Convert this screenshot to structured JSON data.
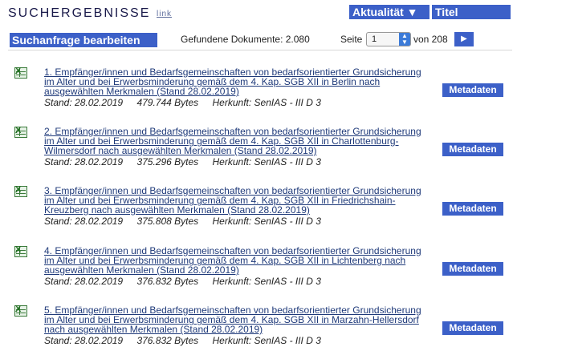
{
  "header": {
    "title": "SUCHERGEBNISSE",
    "link_label": "link",
    "sort_date_label": "Aktualität ▼",
    "sort_title_label": "Titel"
  },
  "toolbar": {
    "edit_query_label": "Suchanfrage bearbeiten",
    "found_documents": "Gefundene Dokumente: 2.080",
    "page_label": "Seite",
    "page_value": "1",
    "of_label": "von 208",
    "next_icon": "▶"
  },
  "results": [
    {
      "title": "1. Empfänger/innen und Bedarfsgemeinschaften von bedarfsorientierter Grundsicherung im Alter und bei Erwerbsminderung gemäß dem 4. Kap. SGB XII in Berlin nach ausgewählten Merkmalen (Stand 28.02.2019)",
      "stand": "Stand: 28.02.2019",
      "size": "479.744 Bytes",
      "origin": "Herkunft: SenIAS - III D 3",
      "meta_label": "Metadaten"
    },
    {
      "title": "2. Empfänger/innen und Bedarfsgemeinschaften von bedarfsorientierter Grundsicherung im Alter und bei Erwerbsminderung gemäß dem 4. Kap. SGB XII in Charlottenburg-Wilmersdorf nach ausgewählten Merkmalen (Stand 28.02.2019)",
      "stand": "Stand: 28.02.2019",
      "size": "375.296 Bytes",
      "origin": "Herkunft: SenIAS - III D 3",
      "meta_label": "Metadaten"
    },
    {
      "title": "3. Empfänger/innen und Bedarfsgemeinschaften von bedarfsorientierter Grundsicherung im Alter und bei Erwerbsminderung gemäß dem 4. Kap. SGB XII in Friedrichshain-Kreuzberg nach ausgewählten Merkmalen (Stand 28.02.2019)",
      "stand": "Stand: 28.02.2019",
      "size": "375.808 Bytes",
      "origin": "Herkunft: SenIAS - III D 3",
      "meta_label": "Metadaten"
    },
    {
      "title": "4. Empfänger/innen und Bedarfsgemeinschaften von bedarfsorientierter Grundsicherung im Alter und bei Erwerbsminderung gemäß dem 4. Kap. SGB XII in Lichtenberg nach ausgewählten Merkmalen (Stand 28.02.2019)",
      "stand": "Stand: 28.02.2019",
      "size": "376.832 Bytes",
      "origin": "Herkunft: SenIAS - III D 3",
      "meta_label": "Metadaten"
    },
    {
      "title": "5. Empfänger/innen und Bedarfsgemeinschaften von bedarfsorientierter Grundsicherung im Alter und bei Erwerbsminderung gemäß dem 4. Kap. SGB XII in Marzahn-Hellersdorf nach ausgewählten Merkmalen (Stand 28.02.2019)",
      "stand": "Stand: 28.02.2019",
      "size": "376.832 Bytes",
      "origin": "Herkunft: SenIAS - III D 3",
      "meta_label": "Metadaten"
    }
  ]
}
